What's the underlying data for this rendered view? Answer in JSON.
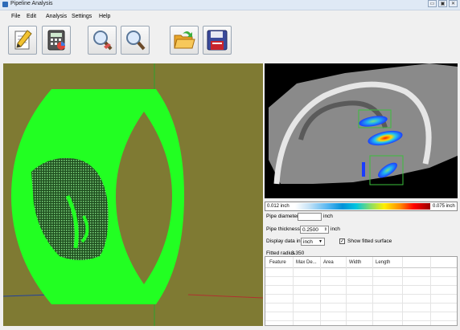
{
  "window": {
    "title": "Pipeline Analysis"
  },
  "window_buttons": [
    "▭",
    "▣",
    "✕"
  ],
  "menu": [
    "File",
    "Edit",
    "Analysis",
    "Settings",
    "Help"
  ],
  "toolbar": {
    "buttons": [
      {
        "icon": "pencil-notepad-icon"
      },
      {
        "icon": "calculator-icon"
      },
      {
        "icon": "magnifier-icon"
      },
      {
        "icon": "magnifier-icon"
      },
      {
        "icon": "open-folder-icon"
      },
      {
        "icon": "save-disk-icon"
      }
    ]
  },
  "scale": {
    "min_label": "0.012 inch",
    "max_label": "0.075 inch"
  },
  "form": {
    "pipe_diameter_label": "Pipe diameter",
    "pipe_diameter_value": "",
    "pipe_diameter_unit": "inch",
    "pipe_thickness_label": "Pipe thickness",
    "pipe_thickness_value": "0.2500",
    "pipe_thickness_unit": "inch",
    "display_label": "Display data in",
    "display_value": "inch",
    "show_fitted_label": "Show fitted surface",
    "show_fitted_checked": true,
    "fitted_radius_label": "Fitted radius",
    "fitted_radius_value": "3.350"
  },
  "table": {
    "columns": [
      "Feature",
      "Max De...",
      "Area",
      "Width",
      "Length"
    ],
    "rows": []
  },
  "colors": {
    "viewport_bg": "#7f7a33",
    "pipe_surface": "#22ff22",
    "scan_bg": "#000000"
  }
}
